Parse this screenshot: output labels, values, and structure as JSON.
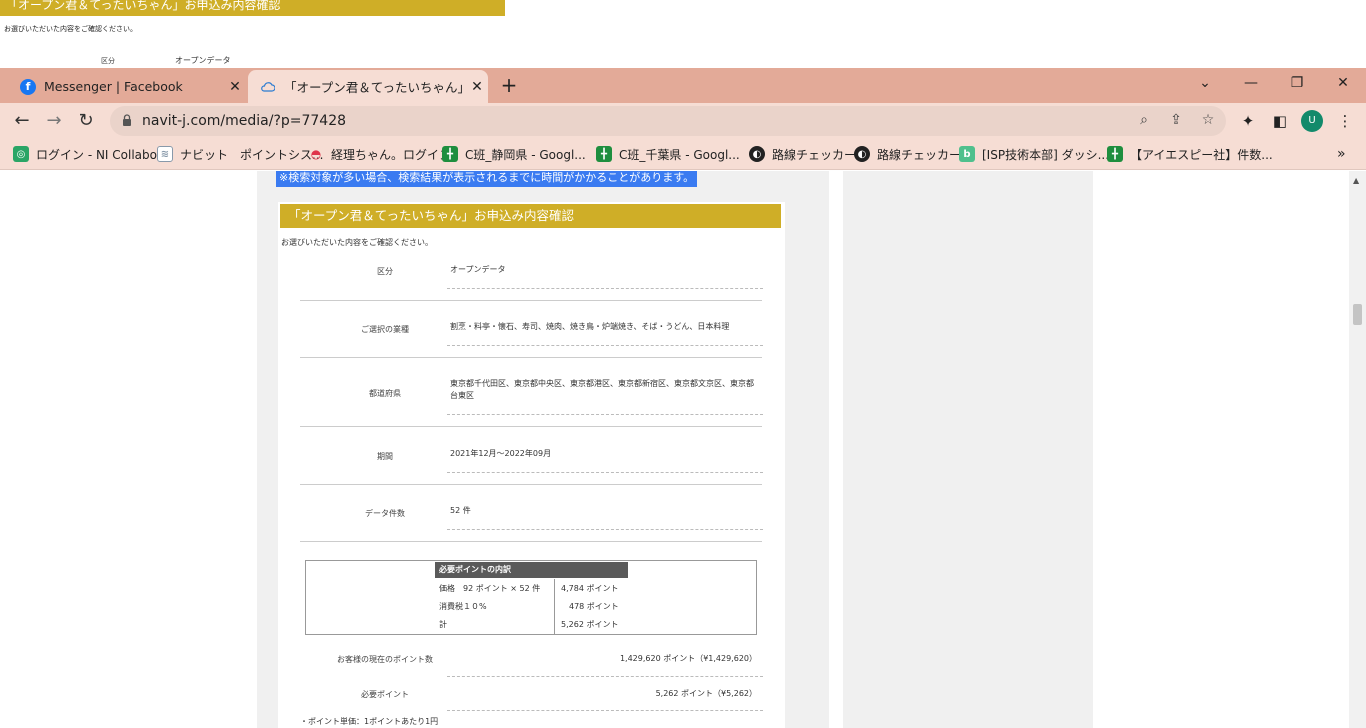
{
  "background_page": {
    "title": "「オープン君＆てったいちゃん」お申込み内容確認",
    "note": "お選びいただいた内容をご確認ください。",
    "kubun_label": "区分",
    "kubun_value": "オープンデータ"
  },
  "tabs": [
    {
      "label": "Messenger | Facebook",
      "icon": "facebook-icon",
      "close": "✕"
    },
    {
      "label": "「オープン君＆てったいちゃん」で市区町",
      "icon": "cloud-icon",
      "close": "✕"
    }
  ],
  "new_tab": "+",
  "window_controls": {
    "dropdown": "⌄",
    "minimize": "—",
    "restore": "❐",
    "close": "✕"
  },
  "toolbar": {
    "back": "←",
    "forward": "→",
    "reload": "↻",
    "url": "navit-j.com/media/?p=77428",
    "profile_initial": "U"
  },
  "bookmarks": [
    {
      "label": "ログイン - NI Collabo",
      "icon": "nicollabo-icon",
      "color": "#2aa566"
    },
    {
      "label": "ナビット　ポイントシス...",
      "icon": "bucket-icon",
      "color": "#8899aa"
    },
    {
      "label": "経理ちゃん。ログイン",
      "icon": "lips-icon",
      "color": "#e0334a"
    },
    {
      "label": "C班_静岡県 - Googl...",
      "icon": "google-sheets-icon",
      "color": "#1e8e3e"
    },
    {
      "label": "C班_千葉県 - Googl...",
      "icon": "google-sheets-icon",
      "color": "#1e8e3e"
    },
    {
      "label": "路線チェッカー",
      "icon": "globe-icon",
      "color": "#333333"
    },
    {
      "label": "路線チェッカー",
      "icon": "globe-icon",
      "color": "#333333"
    },
    {
      "label": "[ISP技術本部] ダッシ...",
      "icon": "b-icon",
      "color": "#4fc08d"
    },
    {
      "label": "【アイエスピー社】件数...",
      "icon": "google-sheets-icon",
      "color": "#1e8e3e"
    }
  ],
  "bookmarks_overflow": "»",
  "page": {
    "notice": "※検索対象が多い場合、検索結果が表示されるまでに時間がかかることがあります。",
    "card_title": "「オープン君＆てったいちゃん」お申込み内容確認",
    "card_note": "お選びいただいた内容をご確認ください。",
    "rows": [
      {
        "label": "区分",
        "value": "オープンデータ"
      },
      {
        "label": "ご選択の業種",
        "value": "割烹・料亭・懐石、寿司、焼肉、焼き鳥・炉端焼き、そば・うどん、日本料理"
      },
      {
        "label": "都道府県",
        "value": "東京都千代田区、東京都中央区、東京都港区、東京都新宿区、東京都文京区、東京都台東区"
      },
      {
        "label": "期間",
        "value": "2021年12月～2022年09月"
      },
      {
        "label": "データ件数",
        "value": "52 件"
      }
    ],
    "breakdown": {
      "header": "必要ポイントの内訳",
      "rows": [
        {
          "item": "価格　92 ポイント × 52 件",
          "amount": "4,784 ポイント"
        },
        {
          "item": "消費税１０%",
          "amount": "　478 ポイント"
        },
        {
          "item": "計",
          "amount": "5,262 ポイント"
        }
      ]
    },
    "current_points_label": "お客様の現在のポイント数",
    "current_points_value": "1,429,620 ポイント（¥1,429,620）",
    "required_points_label": "必要ポイント",
    "required_points_value": "5,262 ポイント（¥5,262）",
    "unit_note": "・ポイント単価：1ポイントあたり1円"
  }
}
